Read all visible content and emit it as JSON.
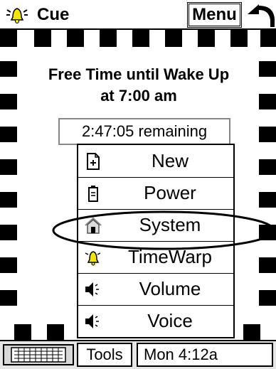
{
  "title_bar": {
    "app_title": "Cue",
    "menu_label": "Menu",
    "icons": {
      "app": "bell-icon",
      "back": "back-arrow-icon"
    }
  },
  "alarm": {
    "title": "Free Time until Wake Up",
    "time": "at 7:00 am",
    "countdown": "2:47:05 remaining"
  },
  "popup_menu": {
    "items": [
      {
        "label": "New",
        "icon": "new-document-icon"
      },
      {
        "label": "Power",
        "icon": "battery-icon"
      },
      {
        "label": "System",
        "icon": "house-icon",
        "highlighted": true
      },
      {
        "label": "TimeWarp",
        "icon": "bell-icon"
      },
      {
        "label": "Volume",
        "icon": "speaker-icon"
      },
      {
        "label": "Voice",
        "icon": "speaker-icon"
      }
    ]
  },
  "taskbar": {
    "tools_label": "Tools",
    "clock": "Mon 4:12a",
    "icons": {
      "keyboard": "keyboard-icon"
    }
  },
  "colors": {
    "background": "#ffffff",
    "border": "#000000",
    "bell": "#f2e600",
    "taskbar": "#e6e6e6"
  }
}
